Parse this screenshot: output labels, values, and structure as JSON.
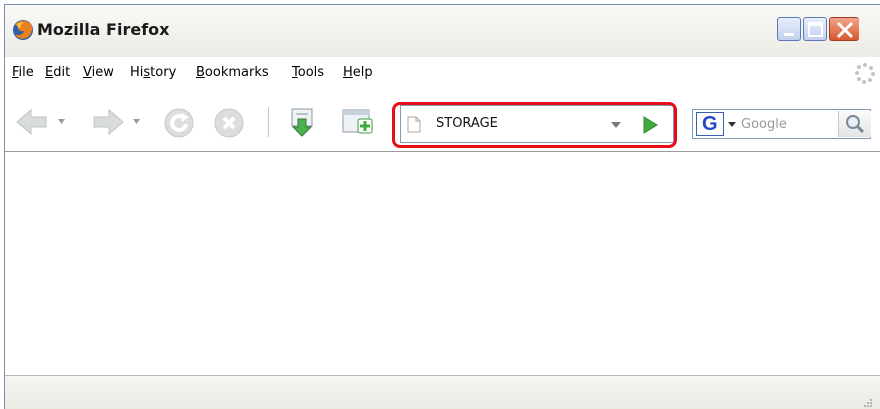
{
  "window": {
    "title": "Mozilla Firefox",
    "icon": "firefox-logo-icon",
    "controls": [
      "minimize-icon",
      "maximize-icon",
      "close-icon"
    ]
  },
  "menubar": {
    "items": [
      {
        "label": "File",
        "accel": "F"
      },
      {
        "label": "Edit",
        "accel": "E"
      },
      {
        "label": "View",
        "accel": "V"
      },
      {
        "label": "History",
        "accel": "s"
      },
      {
        "label": "Bookmarks",
        "accel": "B"
      },
      {
        "label": "Tools",
        "accel": "T"
      },
      {
        "label": "Help",
        "accel": "H"
      }
    ]
  },
  "toolbar": {
    "buttons": [
      "back-icon",
      "forward-icon",
      "reload-icon",
      "stop-icon",
      "download-icon",
      "new-tab-icon"
    ],
    "address": {
      "value": "STORAGE",
      "highlight_color": "#e60d15"
    },
    "search": {
      "engine_letter": "G",
      "placeholder": "Google"
    }
  },
  "statusbar": {
    "text": ""
  },
  "colors": {
    "go_arrow": "#3daa3d",
    "close_button": "#d8572e",
    "engine_blue": "#2249c9"
  }
}
